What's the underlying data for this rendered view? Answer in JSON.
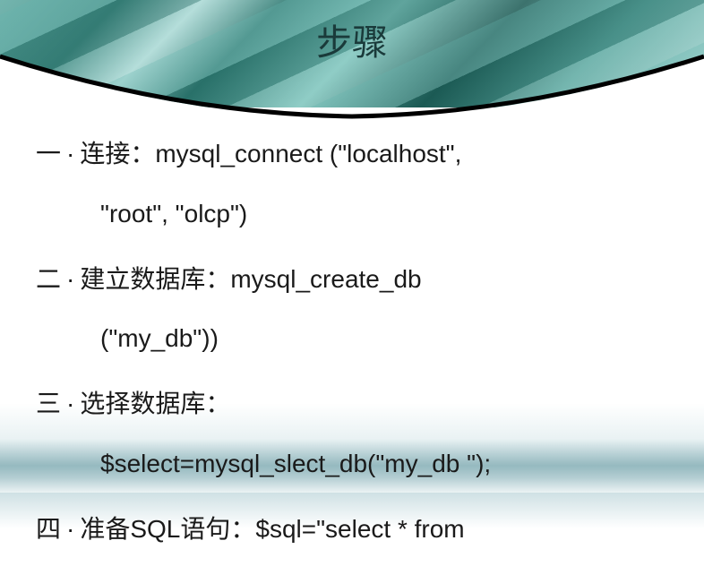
{
  "title": "步骤",
  "steps": [
    {
      "num": "一",
      "label": "连接：",
      "code_line1": "mysql_connect (\"localhost\",",
      "code_line2": "\"root\", \"olcp\")"
    },
    {
      "num": "二",
      "label": "建立数据库：",
      "code_line1": "mysql_create_db",
      "code_line2": "(\"my_db\"))"
    },
    {
      "num": "三",
      "label": "选择数据库：",
      "code_line1": "",
      "code_line2": "$select=mysql_slect_db(\"my_db \");"
    },
    {
      "num": "四",
      "label": "准备SQL语句：",
      "code_line1": "$sql=\"select * from",
      "code_line2": ""
    }
  ]
}
